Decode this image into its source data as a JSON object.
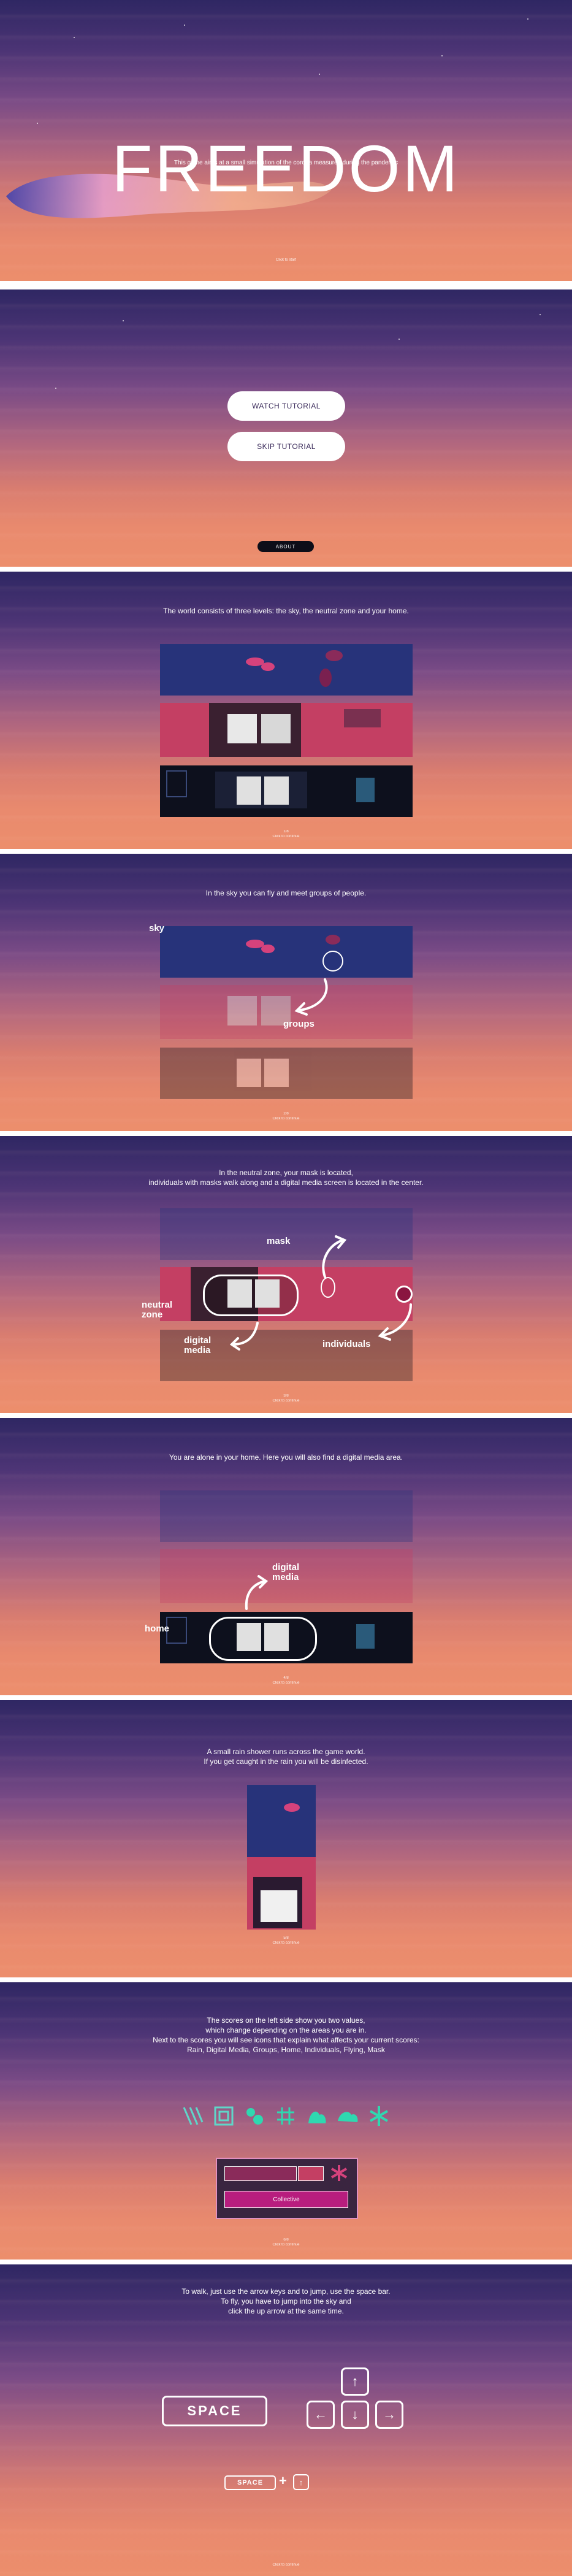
{
  "intro": {
    "title": "FREEDOM",
    "subtitle": "This game aims at a small simulation of the corona measures during the pandemic",
    "hint": "Click to start"
  },
  "menu": {
    "watch_label": "WATCH TUTORIAL",
    "skip_label": "SKIP TUTORIAL",
    "about_label": "ABOUT"
  },
  "tutorial": {
    "progress_label": "Click to continue",
    "slides": [
      {
        "counter": "1/8",
        "text": "The world consists of three levels: the sky, the neutral zone and your home."
      },
      {
        "counter": "2/8",
        "text": "In the sky you can fly and meet groups of people."
      },
      {
        "counter": "3/8",
        "text_line1": "In the neutral zone, your mask is located,",
        "text_line2": "individuals with masks walk along and a digital media screen is located in the center."
      },
      {
        "counter": "4/8",
        "text": "You are alone in your home. Here you will also find a digital media area."
      },
      {
        "counter": "5/8",
        "text_line1": "A small rain shower runs across the game world.",
        "text_line2": "If you get caught in the rain you will be disinfected."
      },
      {
        "counter": "6/8",
        "text_line1": "The scores on the left side show you two values,",
        "text_line2": "which change depending on the areas you are in.",
        "text_line3": "Next to the scores you will see icons that explain what affects your current scores:",
        "text_line4": "Rain, Digital Media, Groups, Home, Individuals, Flying, Mask"
      },
      {
        "counter": "7/8",
        "text_line1": "To walk, just use the arrow keys and to jump, use the space bar.",
        "text_line2": "To fly, you have to jump into the sky and",
        "text_line3": "click the up arrow at the same time."
      }
    ]
  },
  "labels": {
    "sky": "sky",
    "groups": "groups",
    "mask": "mask",
    "neutral_zone_1": "neutral",
    "neutral_zone_2": "zone",
    "digital_media_1": "digital",
    "digital_media_2": "media",
    "individuals": "individuals",
    "home": "home"
  },
  "scores": {
    "collective_label": "Collective"
  },
  "keys": {
    "space": "SPACE",
    "space_small": "SPACE",
    "plus": "+",
    "up": "↑",
    "down": "↓",
    "left": "←",
    "right": "→"
  },
  "colors": {
    "sky_blue": "#27337a",
    "neutral_pink": "#c43f63",
    "home_dark": "#0d101d",
    "accent_teal": "#2fd8b0"
  }
}
